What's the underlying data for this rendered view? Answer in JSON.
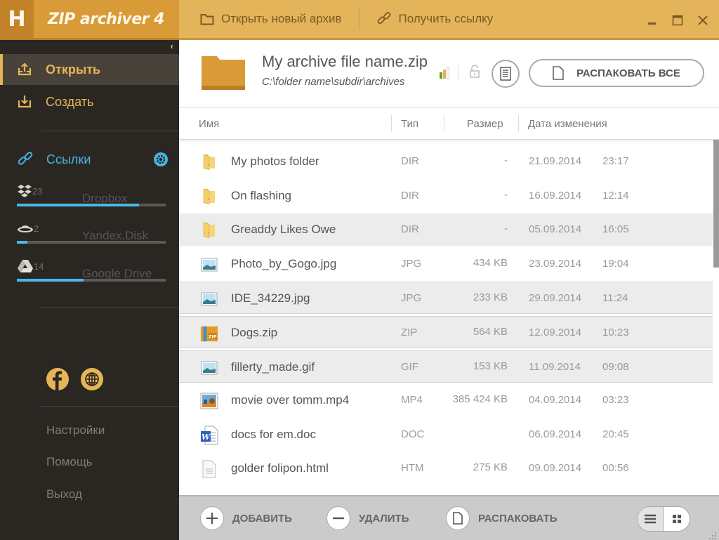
{
  "app": {
    "logo_letter": "H",
    "title": "ZIP archiver 4"
  },
  "toolbar": {
    "open_new_archive": "Открыть новый архив",
    "get_link": "Получить ссылку"
  },
  "sidebar": {
    "collapse_glyph": "‹",
    "nav": [
      {
        "label": "Открыть",
        "icon": "open-upload-icon",
        "active": true
      },
      {
        "label": "Создать",
        "icon": "create-download-icon",
        "active": false
      }
    ],
    "links": {
      "label": "Ссылки",
      "icon": "link-icon",
      "settings_icon": "gear-icon"
    },
    "clouds": [
      {
        "name": "Dropbox",
        "count": "23",
        "icon": "dropbox-icon",
        "usage_percent": 82
      },
      {
        "name": "Yandex.Disk",
        "count": "2",
        "icon": "yandex-disk-icon",
        "usage_percent": 7
      },
      {
        "name": "Google Drive",
        "count": "14",
        "icon": "google-drive-icon",
        "usage_percent": 45
      }
    ],
    "social": [
      "facebook-icon",
      "globe-icon"
    ],
    "footer": [
      {
        "label": "Настройки"
      },
      {
        "label": "Помощь"
      },
      {
        "label": "Выход"
      }
    ]
  },
  "archive": {
    "name": "My archive file name.zip",
    "path": "C:\\folder name\\subdir\\archives",
    "compression_level": 2,
    "compression_max": 3,
    "extract_all_label": "РАСПАКОВАТЬ ВСЕ"
  },
  "columns": {
    "name": "Имя",
    "type": "Тип",
    "size": "Размер",
    "date": "Дата изменения"
  },
  "files": [
    {
      "name": "My photos folder",
      "type": "DIR",
      "size": "-",
      "date": "21.09.2014",
      "time": "23:17",
      "icon": "folder",
      "state": ""
    },
    {
      "name": "On flashing",
      "type": "DIR",
      "size": "-",
      "date": "16.09.2014",
      "time": "12:14",
      "icon": "folder",
      "state": ""
    },
    {
      "name": "Greaddy Likes Owe",
      "type": "DIR",
      "size": "-",
      "date": "05.09.2014",
      "time": "16:05",
      "icon": "folder",
      "state": "hl"
    },
    {
      "name": "Photo_by_Gogo.jpg",
      "type": "JPG",
      "size": "434 KB",
      "date": "23.09.2014",
      "time": "19:04",
      "icon": "image",
      "state": ""
    },
    {
      "name": "IDE_34229.jpg",
      "type": "JPG",
      "size": "233 KB",
      "date": "29.09.2014",
      "time": "11:24",
      "icon": "image",
      "state": "sel"
    },
    {
      "name": "Dogs.zip",
      "type": "ZIP",
      "size": "564 KB",
      "date": "12.09.2014",
      "time": "10:23",
      "icon": "zip",
      "state": "sel"
    },
    {
      "name": "fillerty_made.gif",
      "type": "GIF",
      "size": "153 KB",
      "date": "11.09.2014",
      "time": "09:08",
      "icon": "image",
      "state": "sel"
    },
    {
      "name": "movie over tomm.mp4",
      "type": "MP4",
      "size": "385 424 KB",
      "date": "04.09.2014",
      "time": "03:23",
      "icon": "video",
      "state": ""
    },
    {
      "name": "docs for em.doc",
      "type": "DOC",
      "size": "",
      "date": "06.09.2014",
      "time": "20:45",
      "icon": "word",
      "state": ""
    },
    {
      "name": "golder folipon.html",
      "type": "HTM",
      "size": "275 KB",
      "date": "09.09.2014",
      "time": "00:56",
      "icon": "doc",
      "state": ""
    }
  ],
  "bottombar": {
    "add": "ДОБАВИТЬ",
    "delete": "УДАЛИТЬ",
    "extract": "РАСПАКОВАТЬ"
  },
  "colors": {
    "accent_gold": "#e6b556",
    "brand_orange": "#d99a38",
    "link_blue": "#47b3e0",
    "sidebar_bg": "#2a2723"
  }
}
